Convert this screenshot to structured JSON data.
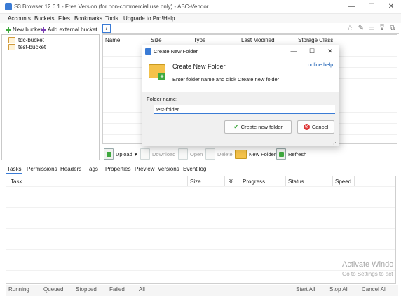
{
  "window": {
    "title": "S3 Browser 12.6.1 - Free Version (for non-commercial use only) - ABC-Vendor",
    "min": "—",
    "max": "☐",
    "close": "✕"
  },
  "menu": [
    "Accounts",
    "Buckets",
    "Files",
    "Bookmarks",
    "Tools",
    "Upgrade to Pro!",
    "Help"
  ],
  "bucket_toolbar": {
    "new_bucket": "New bucket",
    "add_external": "Add external bucket",
    "more": "»"
  },
  "buckets": [
    "tdc-bucket",
    "test-bucket"
  ],
  "path": "/",
  "file_table": {
    "columns": [
      "Name",
      "Size",
      "Type",
      "Last Modified",
      "Storage Class"
    ]
  },
  "file_actions": {
    "upload": "Upload",
    "upload_caret": "▾",
    "download": "Download",
    "open": "Open",
    "delete": "Delete",
    "new_folder": "New Folder",
    "refresh": "Refresh"
  },
  "bottom_tabs": [
    "Tasks",
    "Permissions",
    "Headers",
    "Tags",
    "Properties",
    "Preview",
    "Versions",
    "Event log"
  ],
  "task_table": {
    "columns": [
      "Task",
      "Size",
      "%",
      "Progress",
      "Status",
      "Speed"
    ]
  },
  "status_strip": [
    "Running",
    "Queued",
    "Stopped",
    "Failed",
    "All",
    "Start All",
    "Stop All",
    "Cancel All"
  ],
  "watermark": {
    "line1": "Activate Windo",
    "line2": "Go to Settings to act"
  },
  "dialog": {
    "title": "Create New Folder",
    "min": "—",
    "max": "☐",
    "close": "✕",
    "heading": "Create New Folder",
    "description": "Enter folder name and click Create new folder",
    "online_help": "online help",
    "folder_label": "Folder name:",
    "folder_value": "test-folder",
    "create_button": "Create new folder",
    "cancel_button": "Cancel"
  },
  "colors": {
    "accent": "#3a7bd5",
    "link": "#1a5fb4",
    "green": "#3fa93f",
    "purple": "#7b3fb4",
    "folder": "#f4c24a",
    "cancel_red": "#d33"
  }
}
